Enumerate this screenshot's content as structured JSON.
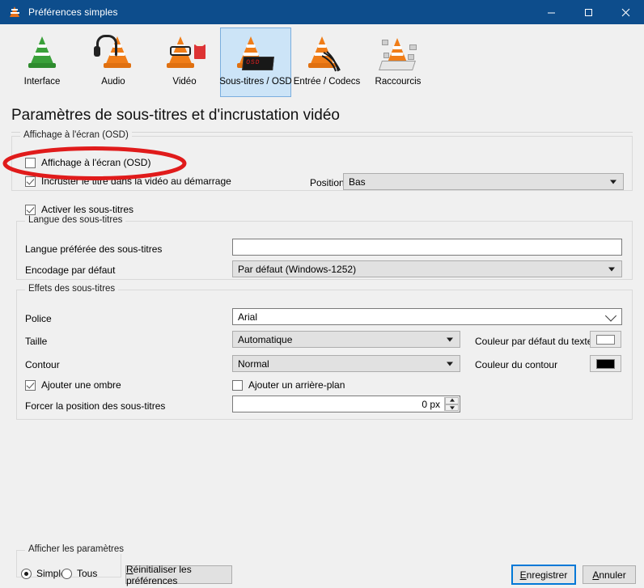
{
  "window": {
    "title": "Préférences simples",
    "icon": "vlc-cone-icon",
    "controls": {
      "minimize": "−",
      "maximize": "□",
      "close": "✕"
    },
    "titlebar_color": "#0d4d8c"
  },
  "toolbar": {
    "items": [
      {
        "label": "Interface",
        "icon": "vlc-interface-icon",
        "selected": false
      },
      {
        "label": "Audio",
        "icon": "vlc-audio-icon",
        "selected": false
      },
      {
        "label": "Vidéo",
        "icon": "vlc-video-icon",
        "selected": false
      },
      {
        "label": "Sous-titres / OSD",
        "icon": "vlc-subtitles-icon",
        "selected": true
      },
      {
        "label": "Entrée / Codecs",
        "icon": "vlc-input-icon",
        "selected": false
      },
      {
        "label": "Raccourcis",
        "icon": "vlc-hotkeys-icon",
        "selected": false
      }
    ],
    "selected_color": "#cce4f7"
  },
  "page": {
    "title": "Paramètres de sous-titres et d'incrustation vidéo"
  },
  "osd_group": {
    "title": "Affichage à l'écran (OSD)",
    "osd_checkbox": {
      "label": "Affichage à l'écran (OSD)",
      "checked": false
    },
    "title_overlay_checkbox": {
      "label": "Incruster le titre dans la vidéo au démarrage",
      "checked": true
    },
    "position_label": "Position",
    "position_value": "Bas"
  },
  "subtitles": {
    "enable_checkbox": {
      "label": "Activer les sous-titres",
      "checked": true
    },
    "language_group": {
      "title": "Langue des sous-titres",
      "preferred_label": "Langue préférée des sous-titres",
      "preferred_value": "",
      "encoding_label": "Encodage par défaut",
      "encoding_value": "Par défaut (Windows-1252)"
    },
    "effects_group": {
      "title": "Effets des sous-titres",
      "font_label": "Police",
      "font_value": "Arial",
      "size_label": "Taille",
      "size_value": "Automatique",
      "outline_label": "Contour",
      "outline_value": "Normal",
      "shadow_checkbox": {
        "label": "Ajouter une ombre",
        "checked": true
      },
      "background_checkbox": {
        "label": "Ajouter un arrière-plan",
        "checked": false
      },
      "force_position_label": "Forcer la position des sous-titres",
      "force_position_value": "0 px",
      "text_color_label": "Couleur par défaut du texte",
      "text_color_value": "#ffffff",
      "outline_color_label": "Couleur du contour",
      "outline_color_value": "#000000"
    }
  },
  "footer": {
    "show_settings_group": "Afficher les paramètres",
    "radio_simple": {
      "label": "Simple",
      "selected": true
    },
    "radio_all": {
      "label": "Tous",
      "selected": false
    },
    "reset_button": {
      "accel": "R",
      "rest": "éinitialiser les préférences"
    },
    "save_button": {
      "accel": "E",
      "rest": "nregistrer"
    },
    "cancel_button": {
      "accel": "A",
      "rest": "nnuler"
    }
  },
  "annotation": {
    "shape": "ellipse",
    "color": "#e01b1b",
    "target": "osd-checkbox"
  }
}
